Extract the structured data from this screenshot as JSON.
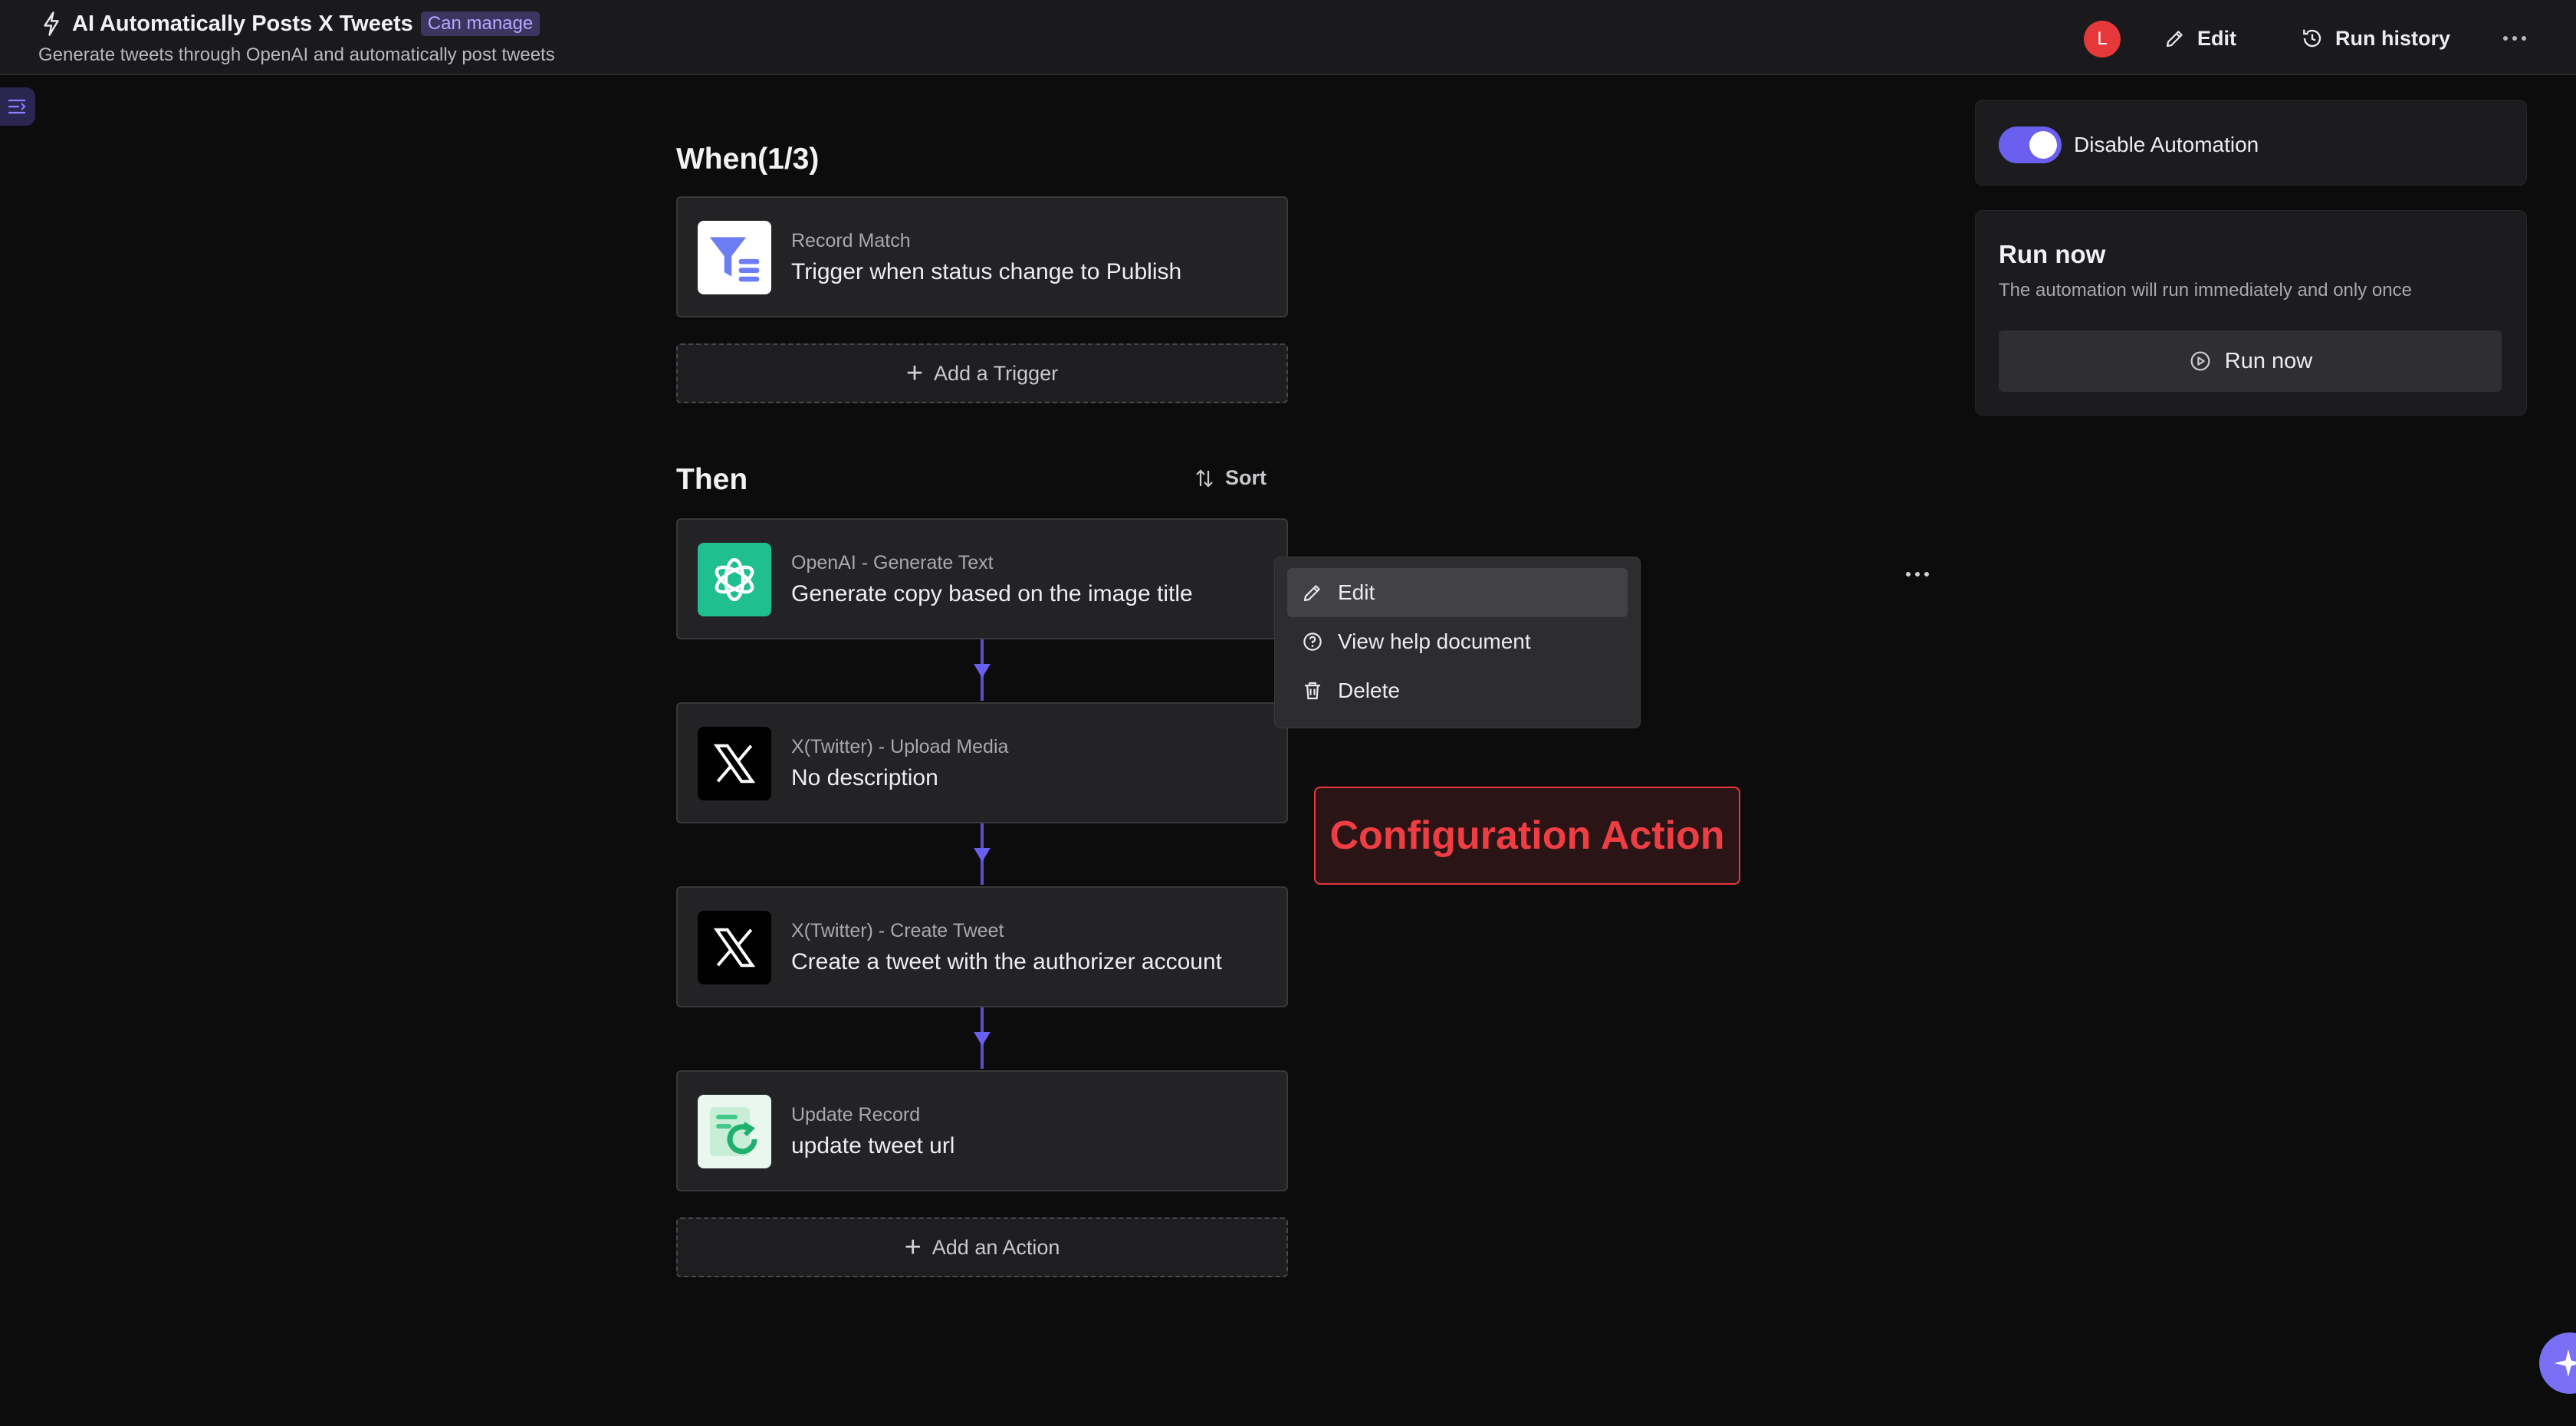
{
  "header": {
    "title": "AI Automatically Posts X Tweets",
    "badge": "Can manage",
    "subtitle": "Generate tweets through OpenAI and automatically post tweets",
    "avatar_initial": "L",
    "edit_label": "Edit",
    "run_history_label": "Run history"
  },
  "when": {
    "title": "When(1/3)",
    "trigger": {
      "category": "Record Match",
      "description": "Trigger when status change to Publish",
      "icon": "filter-icon"
    },
    "add_label": "Add a Trigger"
  },
  "then": {
    "title": "Then",
    "sort_label": "Sort",
    "actions": [
      {
        "category": "OpenAI - Generate Text",
        "description": "Generate copy based on the image title",
        "icon": "openai-icon"
      },
      {
        "category": "X(Twitter) - Upload Media",
        "description": "No description",
        "icon": "x-icon"
      },
      {
        "category": "X(Twitter) - Create Tweet",
        "description": "Create a tweet with the authorizer account",
        "icon": "x-icon"
      },
      {
        "category": "Update Record",
        "description": "update tweet url",
        "icon": "update-record-icon"
      }
    ],
    "add_label": "Add an Action"
  },
  "context_menu": {
    "items": [
      {
        "label": "Edit",
        "icon": "pencil-icon"
      },
      {
        "label": "View help document",
        "icon": "help-icon"
      },
      {
        "label": "Delete",
        "icon": "trash-icon"
      }
    ]
  },
  "callout": {
    "text": "Configuration Action"
  },
  "automation_toggle": {
    "label": "Disable Automation",
    "on": true
  },
  "run_now": {
    "title": "Run now",
    "description": "The automation will run immediately and only once",
    "button_label": "Run now"
  },
  "colors": {
    "accent": "#6b5ff0",
    "openai": "#1fbf8f",
    "callout": "#e5383b"
  }
}
